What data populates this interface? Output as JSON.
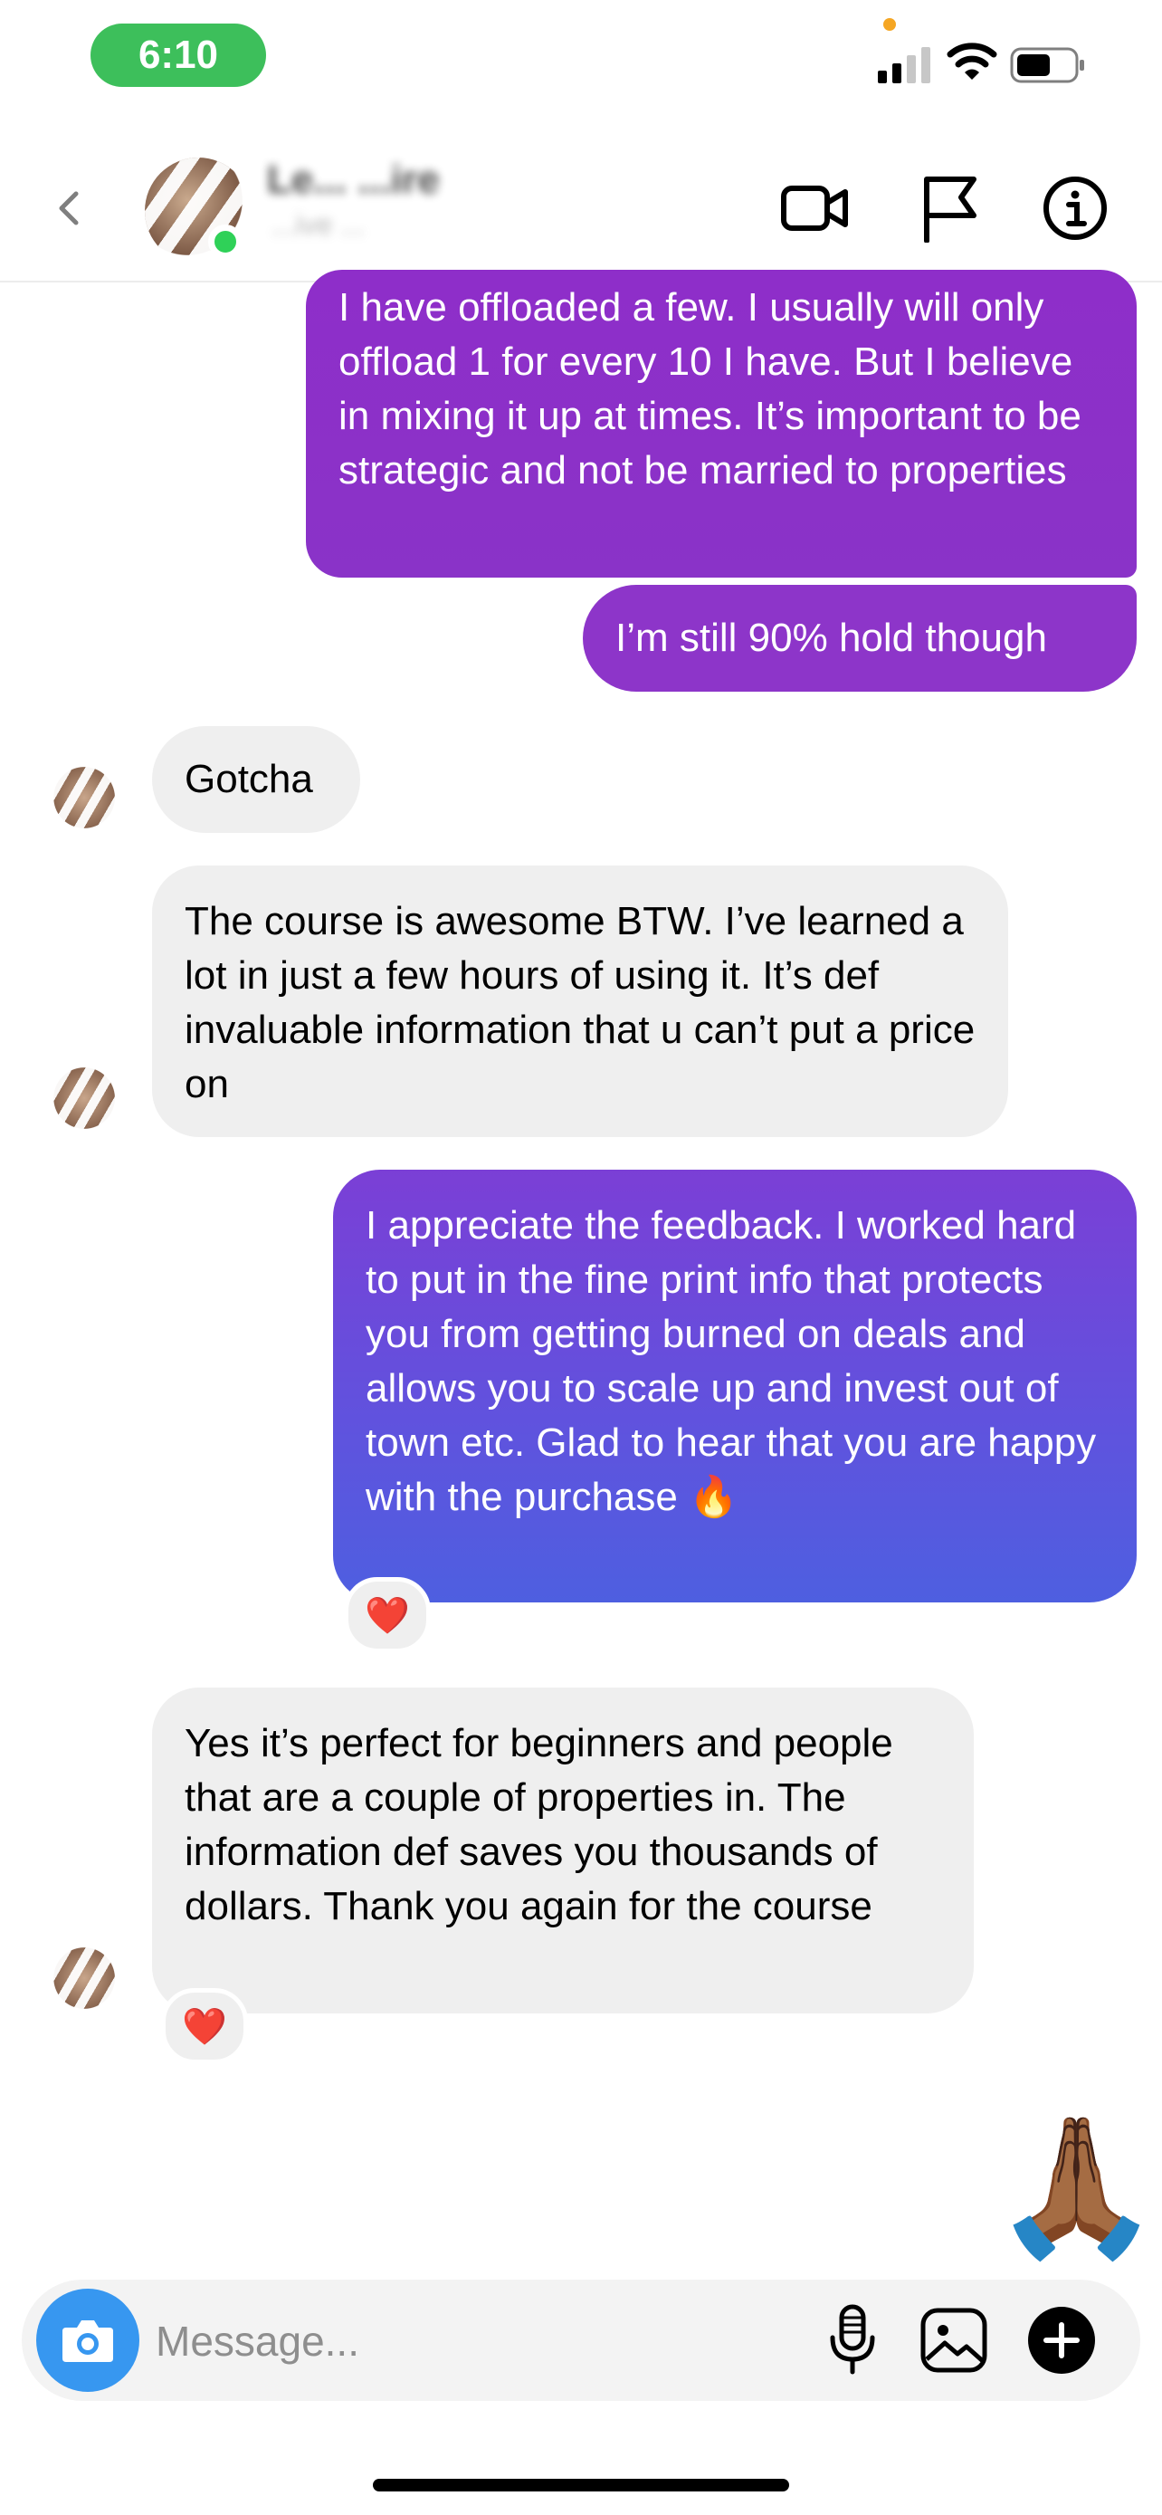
{
  "status_bar": {
    "time": "6:10"
  },
  "header": {
    "name": "Le... ...ire",
    "subtitle": "...ive ..."
  },
  "messages": [
    {
      "id": "m1",
      "side": "out",
      "text": "I have offloaded a few.  I usually will only offload 1 for every 10 I have.  But I believe in mixing it up at times.  It’s important to be strategic and not be married to properties"
    },
    {
      "id": "m2",
      "side": "out",
      "text": "I’m still 90% hold though"
    },
    {
      "id": "m3",
      "side": "in",
      "text": "Gotcha"
    },
    {
      "id": "m4",
      "side": "in",
      "text": "The course is awesome BTW. I’ve learned a lot in just a few hours of using it. It’s def invaluable information that u can’t put a price on"
    },
    {
      "id": "m5",
      "side": "out",
      "text": "I appreciate the feedback.  I worked hard to put in the fine print info that protects you from getting burned on deals and allows you to scale up and invest out of town etc.  Glad to hear that you are happy with the purchase 🔥",
      "reaction": "❤️"
    },
    {
      "id": "m6",
      "side": "in",
      "text": "Yes it’s perfect for beginners and people that are a couple of properties in. The information def saves you thousands of dollars. Thank you again for the course",
      "reaction": "❤️"
    },
    {
      "id": "m7",
      "side": "out",
      "emoji": "🙏🏾"
    }
  ],
  "composer": {
    "placeholder": "Message..."
  },
  "icons": {
    "camera": "camera-icon",
    "mic": "microphone-icon",
    "gallery": "gallery-icon",
    "plus": "plus-icon",
    "video": "video-camera-icon",
    "flag": "flag-icon",
    "info": "info-icon",
    "back": "chevron-left-icon"
  },
  "colors": {
    "accent_blue": "#3797f0",
    "bubble_purple_top": "#8e2ec9",
    "bubble_blue_bottom": "#4e5fe0",
    "incoming_bubble": "#efefef",
    "online": "#2fd158"
  }
}
